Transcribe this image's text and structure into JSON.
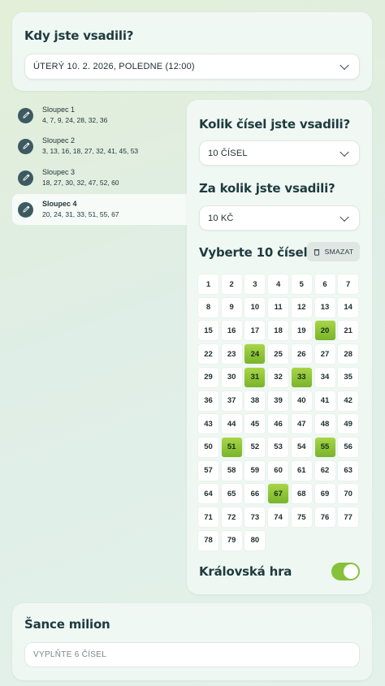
{
  "draw_time": {
    "title": "Kdy jste vsadili?",
    "selected": "ÚTERÝ 10. 2. 2026, POLEDNE (12:00)"
  },
  "columns": [
    {
      "name": "Sloupec 1",
      "numbers": "4, 7, 9, 24, 28, 32, 36",
      "active": false
    },
    {
      "name": "Sloupec 2",
      "numbers": "3, 13, 16, 18, 27, 32, 41, 45, 53",
      "active": false
    },
    {
      "name": "Sloupec 3",
      "numbers": "18, 27, 30, 32, 47, 52, 60",
      "active": false
    },
    {
      "name": "Sloupec 4",
      "numbers": "20, 24, 31, 33, 51, 55, 67",
      "active": true
    }
  ],
  "bet": {
    "count_title": "Kolik čísel jste vsadili?",
    "count_selected": "10 ČÍSEL",
    "amount_title": "Za kolik jste vsadili?",
    "amount_selected": "10 KČ",
    "pick_title": "Vyberte 10 čísel",
    "clear_label": "SMAZAT",
    "numbers_total": 80,
    "selected_numbers": [
      20,
      24,
      31,
      33,
      51,
      55,
      67
    ],
    "royal_label": "Královská hra",
    "royal_on": true
  },
  "million": {
    "title": "Šance milion",
    "placeholder": "VYPLŇTE 6 ČÍSEL"
  },
  "colors": {
    "accent_green": "#86c13a",
    "dark_teal": "#3d5a61"
  }
}
